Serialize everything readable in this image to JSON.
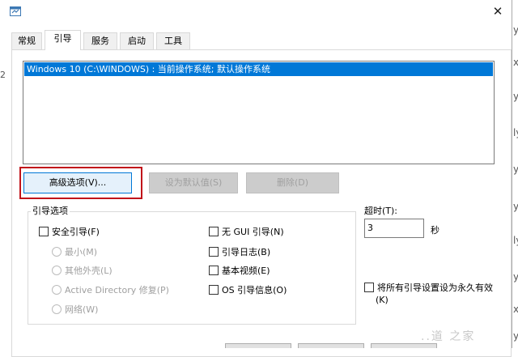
{
  "tabs": [
    {
      "label": "常规"
    },
    {
      "label": "引导"
    },
    {
      "label": "服务"
    },
    {
      "label": "启动"
    },
    {
      "label": "工具"
    }
  ],
  "os_list": {
    "selected_entry": "Windows 10 (C:\\WINDOWS) : 当前操作系统; 默认操作系统"
  },
  "buttons": {
    "advanced": "高级选项(V)...",
    "set_default": "设为默认值(S)",
    "delete": "删除(D)"
  },
  "boot_options": {
    "group_title": "引导选项",
    "safe_boot": "安全引导(F)",
    "minimal": "最小(M)",
    "alternate_shell": "其他外壳(L)",
    "active_directory": "Active Directory 修复(P)",
    "network": "网络(W)",
    "no_gui": "无 GUI 引导(N)",
    "boot_log": "引导日志(B)",
    "base_video": "基本视频(E)",
    "os_boot_info": "OS 引导信息(O)"
  },
  "timeout": {
    "label": "超时(T):",
    "value": "3",
    "unit": "秒"
  },
  "permanent": {
    "label_line1": "将所有引导设置设为永久有效",
    "label_line2": "(K)"
  },
  "watermark": "..道 之家",
  "colors": {
    "selection": "#0078d7",
    "highlight_box": "#c1131a",
    "disabled_text": "#a0a0a0"
  },
  "background_window_chars": [
    "y",
    "x",
    "y",
    "ly",
    "y",
    "y",
    "ly",
    "y",
    "x",
    "y"
  ],
  "background_left_char": "2"
}
